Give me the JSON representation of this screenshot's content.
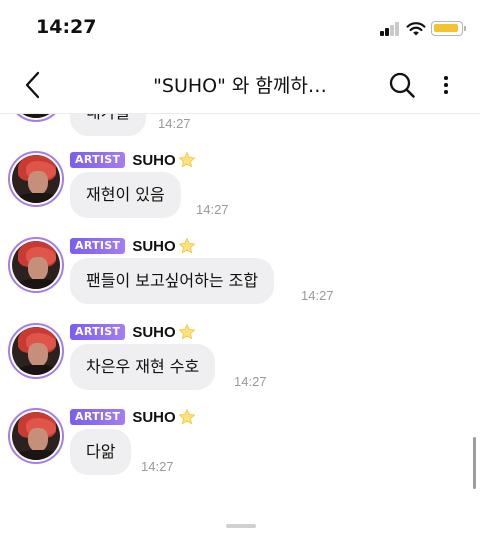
{
  "status_bar": {
    "time": "14:27"
  },
  "nav": {
    "title": "\"SUHO\" 와 함께하…",
    "back_icon": "chevron-left-icon",
    "search_icon": "search-icon",
    "more_icon": "more-vertical-icon"
  },
  "colors": {
    "badge_start": "#7b5ef0",
    "badge_end": "#a47df2",
    "avatar_ring": "#a57ee8",
    "bubble_bg": "#efeff1",
    "timestamp": "#9a9a9a",
    "battery": "#f4c430"
  },
  "previous_message": {
    "text": "내가들",
    "time": "14:27"
  },
  "messages": [
    {
      "badge": "ARTIST",
      "sender": "SUHO",
      "text": "재현이 있음",
      "time": "14:27"
    },
    {
      "badge": "ARTIST",
      "sender": "SUHO",
      "text": "팬들이 보고싶어하는 조합",
      "time": "14:27"
    },
    {
      "badge": "ARTIST",
      "sender": "SUHO",
      "text": "차은우 재현 수호",
      "time": "14:27"
    },
    {
      "badge": "ARTIST",
      "sender": "SUHO",
      "text": "다앎",
      "time": "14:27"
    }
  ]
}
